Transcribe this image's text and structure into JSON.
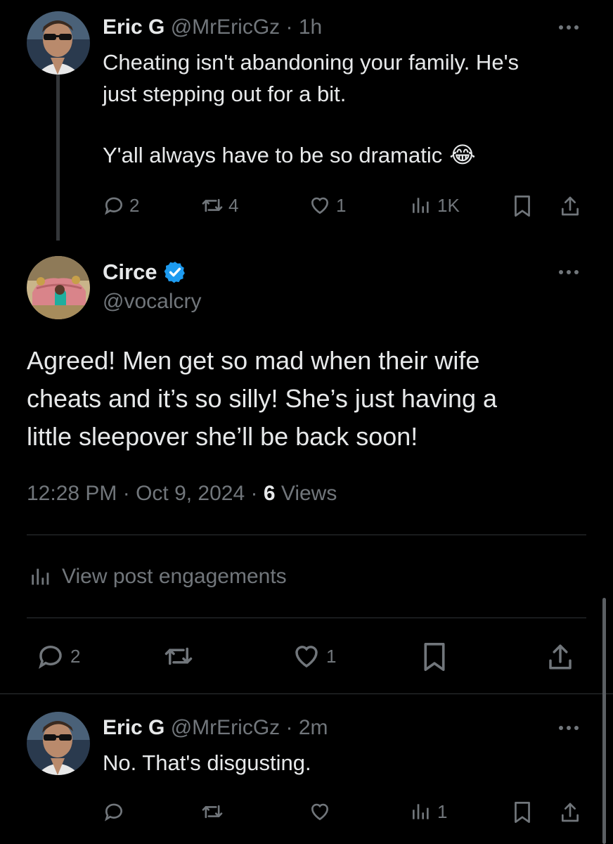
{
  "post1": {
    "name": "Eric G",
    "handle": "@MrEricGz",
    "time": "· 1h",
    "text_line1": "Cheating isn't abandoning your family. He's",
    "text_line2": "just stepping out for a bit.",
    "text_line3": "Y'all always have to be so dramatic",
    "emoji": "😂",
    "replies": "2",
    "reposts": "4",
    "likes": "1",
    "views": "1K"
  },
  "main": {
    "name": "Circe",
    "handle": "@vocalcry",
    "text_line1": "Agreed! Men get so mad when their wife",
    "text_line2": "cheats and it’s so silly! She’s just having a",
    "text_line3": "little sleepover she’ll be back soon!",
    "timestamp": "12:28 PM · Oct 9, 2024 · ",
    "views_count": "6",
    "views_label": " Views",
    "engagements": "View post engagements",
    "replies": "2",
    "likes": "1"
  },
  "reply": {
    "name": "Eric G",
    "handle": "@MrEricGz",
    "time": "· 2m",
    "text": "No. That's disgusting.",
    "views": "1"
  },
  "colors": {
    "verified": "#1d9bf0",
    "muted": "#71767b",
    "text": "#e7e9ea"
  }
}
